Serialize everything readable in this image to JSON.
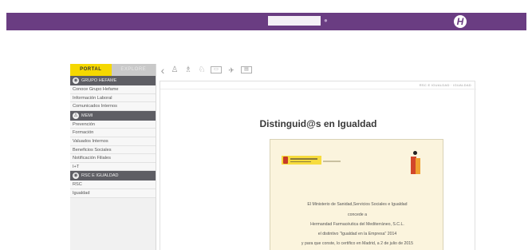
{
  "header": {
    "logo_glyph": "H",
    "brand_color": "#6a3d82"
  },
  "sidebar": {
    "tabs": [
      {
        "label": "PORTAL",
        "active": true
      },
      {
        "label": "EXPLORE",
        "active": false
      }
    ],
    "sections": [
      {
        "title": "GRUPO HEFAME",
        "icon": "globe-icon",
        "items": [
          "Conoce Grupo Hefame",
          "Información Laboral",
          "Comunicados Internos"
        ]
      },
      {
        "title": "MEMI",
        "icon": "person-icon",
        "items": [
          "Prevención",
          "Formación",
          "Valuados Internos",
          "Beneficios Sociales",
          "Notificación Filiales",
          "I+T"
        ]
      },
      {
        "title": "RSC E IGUALDAD",
        "icon": "globe-icon",
        "items": [
          "RSC",
          "Igualdad"
        ]
      }
    ]
  },
  "toolbar": {
    "back_glyph": "‹",
    "icons": [
      "back-icon",
      "person-icon",
      "people-icon",
      "user-group-icon",
      "card-icon",
      "plane-icon",
      "monitor-icon"
    ]
  },
  "content": {
    "breadcrumb": "RSC E IGUALDAD · IGUALDAD",
    "title": "Distinguid@s en Igualdad",
    "certificate": {
      "lines": [
        "El Ministerio de Sanidad,Servicios Sociales e Igualdad",
        "concede a",
        "Hermandad Farmacéutica del Mediterráneo, S.C.L.",
        "el distintivo \"Igualdad en la Empresa\" 2014",
        "y para que conste, lo certifico en Madrid, a 2 de julio de 2015"
      ]
    }
  }
}
